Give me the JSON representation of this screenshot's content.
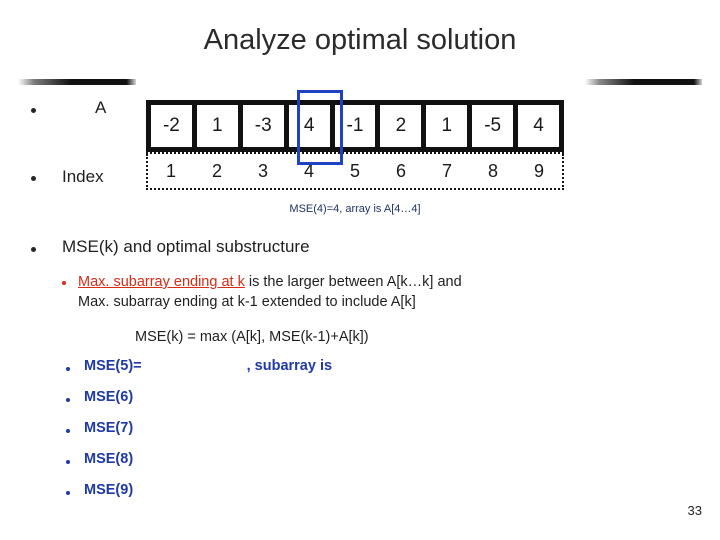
{
  "slide": {
    "title": "Analyze optimal solution",
    "page_number": "33"
  },
  "array_section": {
    "array_label": "A",
    "index_label": "Index",
    "array_values": [
      "-2",
      "1",
      "-3",
      "4",
      "-1",
      "2",
      "1",
      "-5",
      "4"
    ],
    "index_values": [
      "1",
      "2",
      "3",
      "4",
      "5",
      "6",
      "7",
      "8",
      "9"
    ],
    "highlighted_index": 4,
    "highlight_color": "#1f41c4",
    "caption": "MSE(4)=4, array is A[4…4]",
    "caption_color": "#1f3366"
  },
  "body": {
    "heading": "MSE(k) and optimal substructure",
    "rule_link_text": "Max. subarray ending at k",
    "rule_link_color": "#d92b16",
    "rule_rest_line1": " is the larger between A[k…k] and",
    "rule_line2": "Max. subarray ending at k-1 extended to include A[k]",
    "formula": "MSE(k) = max (A[k], MSE(k-1)+A[k])",
    "mse_items": [
      {
        "label": "MSE(5)=",
        "suffix": ", subarray is"
      },
      {
        "label": "MSE(6)",
        "suffix": ""
      },
      {
        "label": "MSE(7)",
        "suffix": ""
      },
      {
        "label": "MSE(8)",
        "suffix": ""
      },
      {
        "label": "MSE(9)",
        "suffix": ""
      }
    ],
    "mse_color": "#1f3aa6"
  }
}
